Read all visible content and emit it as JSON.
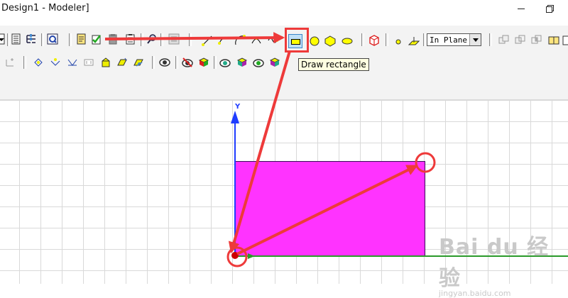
{
  "window": {
    "title": "Design1 - Modeler]"
  },
  "toolbar": {
    "combo_value": "In Plane",
    "tooltip": "Draw rectangle",
    "highlighted_tool_icon": "draw-rectangle-icon",
    "icons_row1": [
      "combo-arrow-icon",
      "list-icon",
      "tree-icon",
      "report-icon",
      "doc-check-icon",
      "doc-check2-icon",
      "clipboard-icon",
      "paste-icon",
      "find-icon",
      "copy-icon",
      "line-icon",
      "spline-icon",
      "arc-icon",
      "arc3pt-icon",
      "equation-icon",
      "draw-rectangle-icon",
      "circle-icon",
      "regular-polygon-icon",
      "ellipse-icon",
      "box-icon",
      "point-icon",
      "plane-icon",
      "combo-icon",
      "union-icon",
      "subtract-icon",
      "intersect-icon",
      "split-icon",
      "sheet-icon"
    ],
    "icons_row2": [
      "coordinate-icon",
      "move-icon",
      "rotate-icon",
      "mirror-icon",
      "scale-icon",
      "sweep-icon",
      "thicken-icon",
      "offset-icon",
      "view-icon",
      "hide-icon",
      "show-icon",
      "display-icon",
      "render-icon",
      "shade-icon",
      "transparency-icon"
    ]
  },
  "viewport": {
    "y_axis_label": "Y",
    "colors": {
      "rectangle_fill": "#ff33ff",
      "y_axis": "#1f3cff",
      "x_axis": "#2a9a2a",
      "annotation": "#ee3a3a"
    }
  },
  "watermark": {
    "logo": "Bai du 经验",
    "sub": "jingyan.baidu.com"
  }
}
